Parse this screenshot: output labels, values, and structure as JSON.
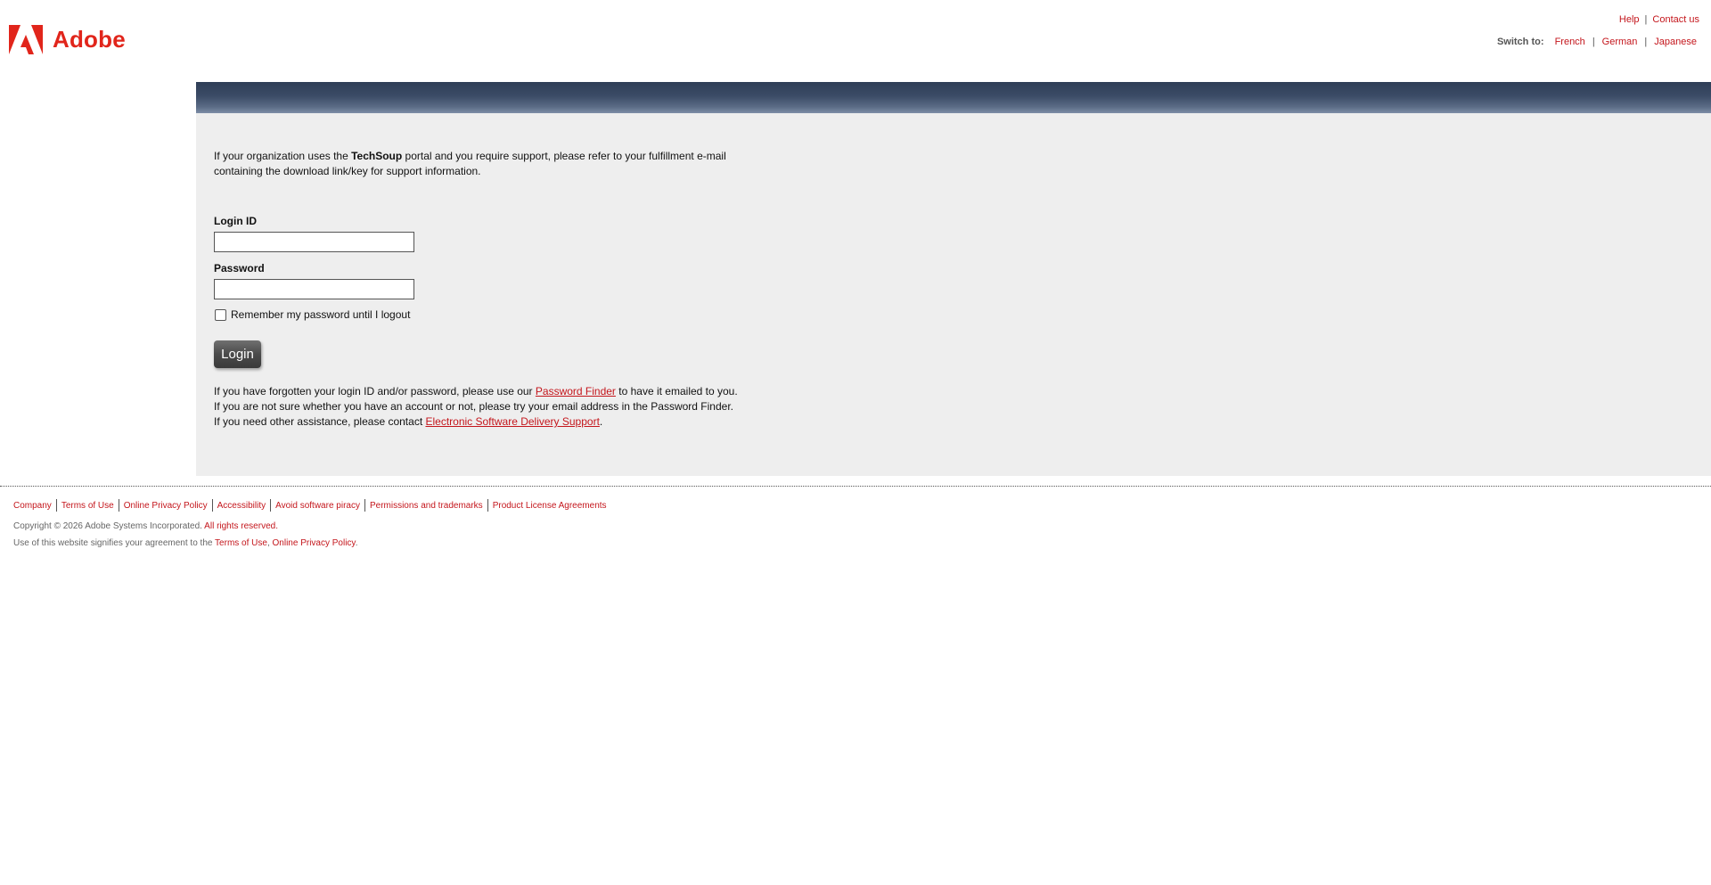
{
  "header": {
    "logo_text": "Adobe",
    "brand_color": "#e1251b",
    "links": {
      "help": "Help",
      "contact": "Contact us",
      "separator": "|"
    },
    "switch_label": "Switch to:",
    "languages": [
      "French",
      "German",
      "Japanese"
    ]
  },
  "main": {
    "intro_before": "If your organization uses the ",
    "intro_bold": "TechSoup",
    "intro_after": " portal and you require support, please refer to your fulfillment e-mail containing the download link/key for support information.",
    "login_label": "Login ID",
    "login_value": "",
    "password_label": "Password",
    "password_value": "",
    "remember_label": "Remember my password until I logout",
    "remember_checked": false,
    "login_button": "Login",
    "help1_before": "If you have forgotten your login ID and/or password, please use our ",
    "help1_link": "Password Finder",
    "help1_after": " to have it emailed to you.",
    "help2": "If you are not sure whether you have an account or not, please try your email address in the Password Finder.",
    "help3_before": "If you need other assistance, please contact ",
    "help3_link": "Electronic Software Delivery Support",
    "help3_after": "."
  },
  "footer": {
    "links": [
      "Company",
      "Terms of Use",
      "Online Privacy Policy",
      "Accessibility",
      "Avoid software piracy",
      "Permissions and trademarks",
      "Product License Agreements"
    ],
    "copyright_text": "Copyright © 2026 Adobe Systems Incorporated. ",
    "copyright_link": "All rights reserved.",
    "agreement_text": "Use of this website signifies your agreement to the ",
    "agreement_link1": "Terms of Use",
    "agreement_comma": ", ",
    "agreement_link2": "Online Privacy Policy",
    "agreement_end": "."
  }
}
